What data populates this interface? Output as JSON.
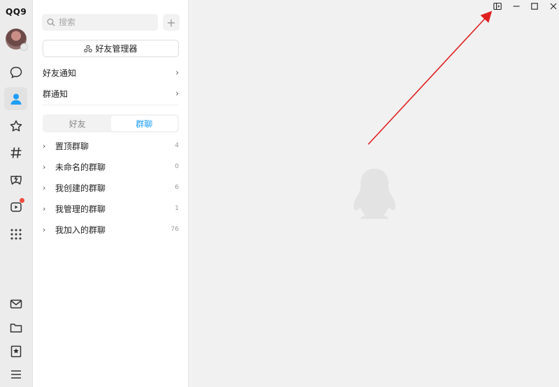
{
  "app": {
    "logo": "QQ9"
  },
  "rail": {
    "items": [
      {
        "icon": "chat-bubble-icon",
        "active": false
      },
      {
        "icon": "contacts-person-icon",
        "active": true
      },
      {
        "icon": "star-icon",
        "active": false
      },
      {
        "icon": "hashtag-icon",
        "active": false
      },
      {
        "icon": "game-icon",
        "active": false
      },
      {
        "icon": "video-play-icon",
        "active": false,
        "badge": true
      },
      {
        "icon": "apps-grid-icon",
        "active": false
      }
    ],
    "bottom_items": [
      "mail-icon",
      "folder-icon",
      "bookmark-star-icon",
      "menu-icon"
    ],
    "accent_color": "#1e9ef8",
    "badge_color": "#f04a3c"
  },
  "panel": {
    "search": {
      "placeholder": "搜索",
      "value": ""
    },
    "add_label": "+",
    "manager_label": "好友管理器",
    "friend_notice": "好友通知",
    "group_notice": "群通知",
    "tabs": [
      {
        "label": "好友",
        "selected": false
      },
      {
        "label": "群聊",
        "selected": true
      }
    ],
    "groups": [
      {
        "name": "置顶群聊",
        "count": "4"
      },
      {
        "name": "未命名的群聊",
        "count": "0"
      },
      {
        "name": "我创建的群聊",
        "count": "6"
      },
      {
        "name": "我管理的群聊",
        "count": "1"
      },
      {
        "name": "我加入的群聊",
        "count": "76"
      }
    ]
  },
  "main": {
    "window_controls": [
      "sidebar-toggle-icon",
      "minimize-icon",
      "maximize-icon",
      "close-icon"
    ],
    "annotation_color": "#e02020"
  }
}
